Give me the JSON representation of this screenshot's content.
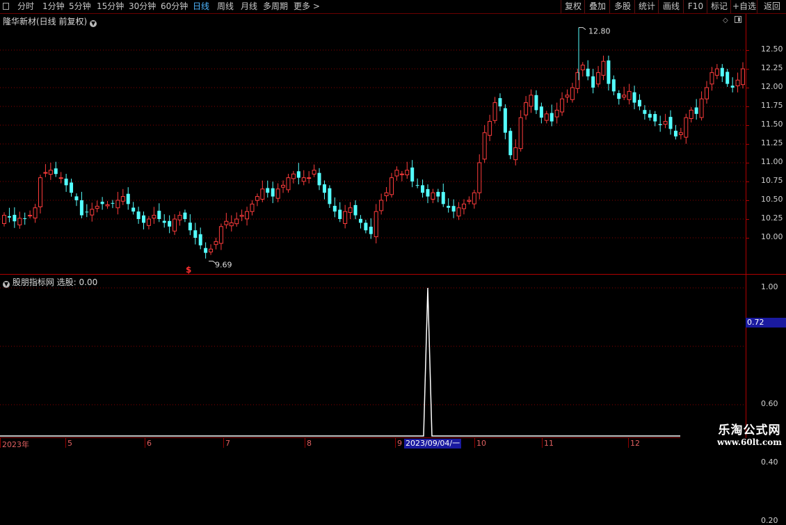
{
  "toolbar": {
    "periods": [
      "分时",
      "1分钟",
      "5分钟",
      "15分钟",
      "30分钟",
      "60分钟",
      "日线",
      "周线",
      "月线",
      "多周期",
      "更多 >"
    ],
    "active_period": "日线",
    "right_buttons": [
      "复权",
      "叠加",
      "多股",
      "统计",
      "画线",
      "F10",
      "标记",
      "+自选",
      "返回"
    ]
  },
  "main_panel": {
    "title": "隆华新材(日线 前复权)",
    "high_label": "12.80",
    "low_label": "9.69",
    "signal_marker": "$",
    "y_ticks": [
      "12.50",
      "12.25",
      "12.00",
      "11.75",
      "11.50",
      "11.25",
      "11.00",
      "10.75",
      "10.50",
      "10.25",
      "10.00"
    ]
  },
  "indicator_panel": {
    "title": "股朋指标网",
    "value_label": "选股: 0.00",
    "y_ticks": [
      "1.00",
      "0.60",
      "0.40",
      "0.20"
    ],
    "current_value": "0.72"
  },
  "x_axis": {
    "labels": [
      "2023年",
      "5",
      "6",
      "7",
      "8",
      "9",
      "10",
      "11",
      "12"
    ],
    "cursor_date": "2023/09/04/一"
  },
  "colors": {
    "up": "#ff3c3c",
    "down": "#54ffff",
    "grid": "#8b0000",
    "active": "#4fb6ff",
    "highlight": "#1a1aa0"
  },
  "watermark": {
    "line1": "乐淘公式网",
    "line2": "www.60lt.com"
  },
  "chart_data": {
    "type": "candlestick",
    "title": "隆华新材(日线 前复权)",
    "ylim": [
      9.6,
      12.9
    ],
    "high": 12.8,
    "low": 9.69,
    "closes": [
      10.3,
      10.27,
      10.22,
      10.26,
      10.25,
      10.3,
      10.4,
      10.8,
      10.87,
      10.9,
      10.85,
      10.8,
      10.7,
      10.6,
      10.5,
      10.3,
      10.34,
      10.38,
      10.42,
      10.45,
      10.44,
      10.46,
      10.5,
      10.55,
      10.45,
      10.35,
      10.25,
      10.2,
      10.25,
      10.3,
      10.25,
      10.2,
      10.15,
      10.25,
      10.3,
      10.25,
      10.1,
      10.0,
      9.9,
      9.8,
      9.85,
      9.95,
      10.15,
      10.22,
      10.2,
      10.25,
      10.3,
      10.35,
      10.45,
      10.55,
      10.65,
      10.6,
      10.55,
      10.65,
      10.7,
      10.8,
      10.85,
      10.8,
      10.8,
      10.8,
      10.9,
      10.7,
      10.6,
      10.45,
      10.35,
      10.25,
      10.35,
      10.4,
      10.3,
      10.2,
      10.1,
      10.05,
      10.35,
      10.5,
      10.6,
      10.8,
      10.9,
      10.85,
      10.9,
      10.75,
      10.7,
      10.6,
      10.55,
      10.6,
      10.55,
      10.45,
      10.4,
      10.35,
      10.4,
      10.45,
      10.5,
      10.6,
      11.0,
      11.4,
      11.55,
      11.8,
      11.75,
      11.4,
      11.1,
      11.2,
      11.6,
      11.8,
      11.9,
      11.7,
      11.6,
      11.65,
      11.55,
      11.7,
      11.85,
      11.9,
      12.0,
      12.2,
      12.3,
      12.15,
      12.0,
      12.2,
      12.35,
      12.05,
      11.95,
      11.85,
      11.9,
      11.95,
      11.8,
      11.75,
      11.65,
      11.6,
      11.55,
      11.5,
      11.55,
      11.45,
      11.35,
      11.4,
      11.6,
      11.7,
      11.65,
      11.85,
      12.0,
      12.2,
      12.25,
      12.15,
      12.05,
      12.0,
      12.1,
      12.25
    ]
  },
  "indicator_data": {
    "signal_index": 82,
    "signal_value": 1.0,
    "ylim": [
      0,
      1.07
    ]
  }
}
